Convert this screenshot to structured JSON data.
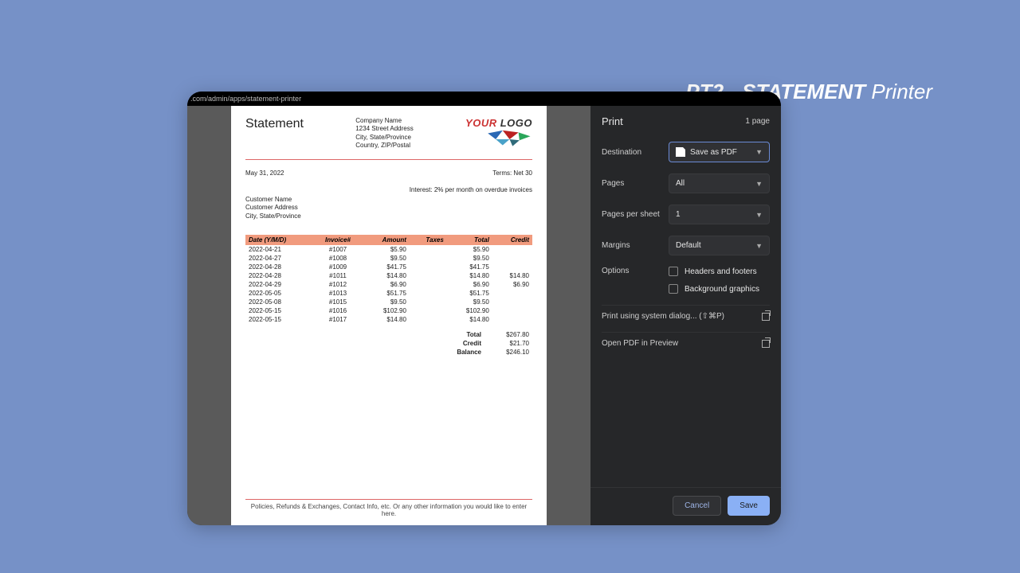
{
  "app_title": {
    "bold1": "PT2 - STATEMENT",
    "rest": "  Printer"
  },
  "url_fragment": ".com/admin/apps/statement-printer",
  "document": {
    "heading": "Statement",
    "company": [
      "Company Name",
      "1234 Street Address",
      "City, State/Province",
      "Country, ZIP/Postal"
    ],
    "logo_text": "YOUR LOGO",
    "date": "May 31, 2022",
    "terms": "Terms: Net 30",
    "interest": "Interest: 2% per month on overdue invoices",
    "customer": [
      "Customer Name",
      "Customer Address",
      "City, State/Province"
    ],
    "columns": [
      "Date (Y/M/D)",
      "Invoice#",
      "Amount",
      "Taxes",
      "Total",
      "Credit"
    ],
    "rows": [
      {
        "date": "2022-04-21",
        "inv": "#1007",
        "amount": "$5.90",
        "taxes": "",
        "total": "$5.90",
        "credit": ""
      },
      {
        "date": "2022-04-27",
        "inv": "#1008",
        "amount": "$9.50",
        "taxes": "",
        "total": "$9.50",
        "credit": ""
      },
      {
        "date": "2022-04-28",
        "inv": "#1009",
        "amount": "$41.75",
        "taxes": "",
        "total": "$41.75",
        "credit": ""
      },
      {
        "date": "2022-04-28",
        "inv": "#1011",
        "amount": "$14.80",
        "taxes": "",
        "total": "$14.80",
        "credit": "$14.80"
      },
      {
        "date": "2022-04-29",
        "inv": "#1012",
        "amount": "$6.90",
        "taxes": "",
        "total": "$6.90",
        "credit": "$6.90"
      },
      {
        "date": "2022-05-05",
        "inv": "#1013",
        "amount": "$51.75",
        "taxes": "",
        "total": "$51.75",
        "credit": ""
      },
      {
        "date": "2022-05-08",
        "inv": "#1015",
        "amount": "$9.50",
        "taxes": "",
        "total": "$9.50",
        "credit": ""
      },
      {
        "date": "2022-05-15",
        "inv": "#1016",
        "amount": "$102.90",
        "taxes": "",
        "total": "$102.90",
        "credit": ""
      },
      {
        "date": "2022-05-15",
        "inv": "#1017",
        "amount": "$14.80",
        "taxes": "",
        "total": "$14.80",
        "credit": ""
      }
    ],
    "totals": [
      {
        "label": "Total",
        "value": "$267.80"
      },
      {
        "label": "Credit",
        "value": "$21.70"
      },
      {
        "label": "Balance",
        "value": "$246.10"
      }
    ],
    "footer": "Policies, Refunds & Exchanges, Contact Info, etc.  Or any other information you would like to enter here."
  },
  "panel": {
    "title": "Print",
    "page_count": "1 page",
    "fields": {
      "destination": {
        "label": "Destination",
        "value": "Save as PDF"
      },
      "pages": {
        "label": "Pages",
        "value": "All"
      },
      "pps": {
        "label": "Pages per sheet",
        "value": "1"
      },
      "margins": {
        "label": "Margins",
        "value": "Default"
      }
    },
    "options_label": "Options",
    "options": {
      "hf": "Headers and footers",
      "bg": "Background graphics"
    },
    "link_system": "Print using system dialog... (⇧⌘P)",
    "link_preview": "Open PDF in Preview",
    "cancel": "Cancel",
    "save": "Save"
  }
}
